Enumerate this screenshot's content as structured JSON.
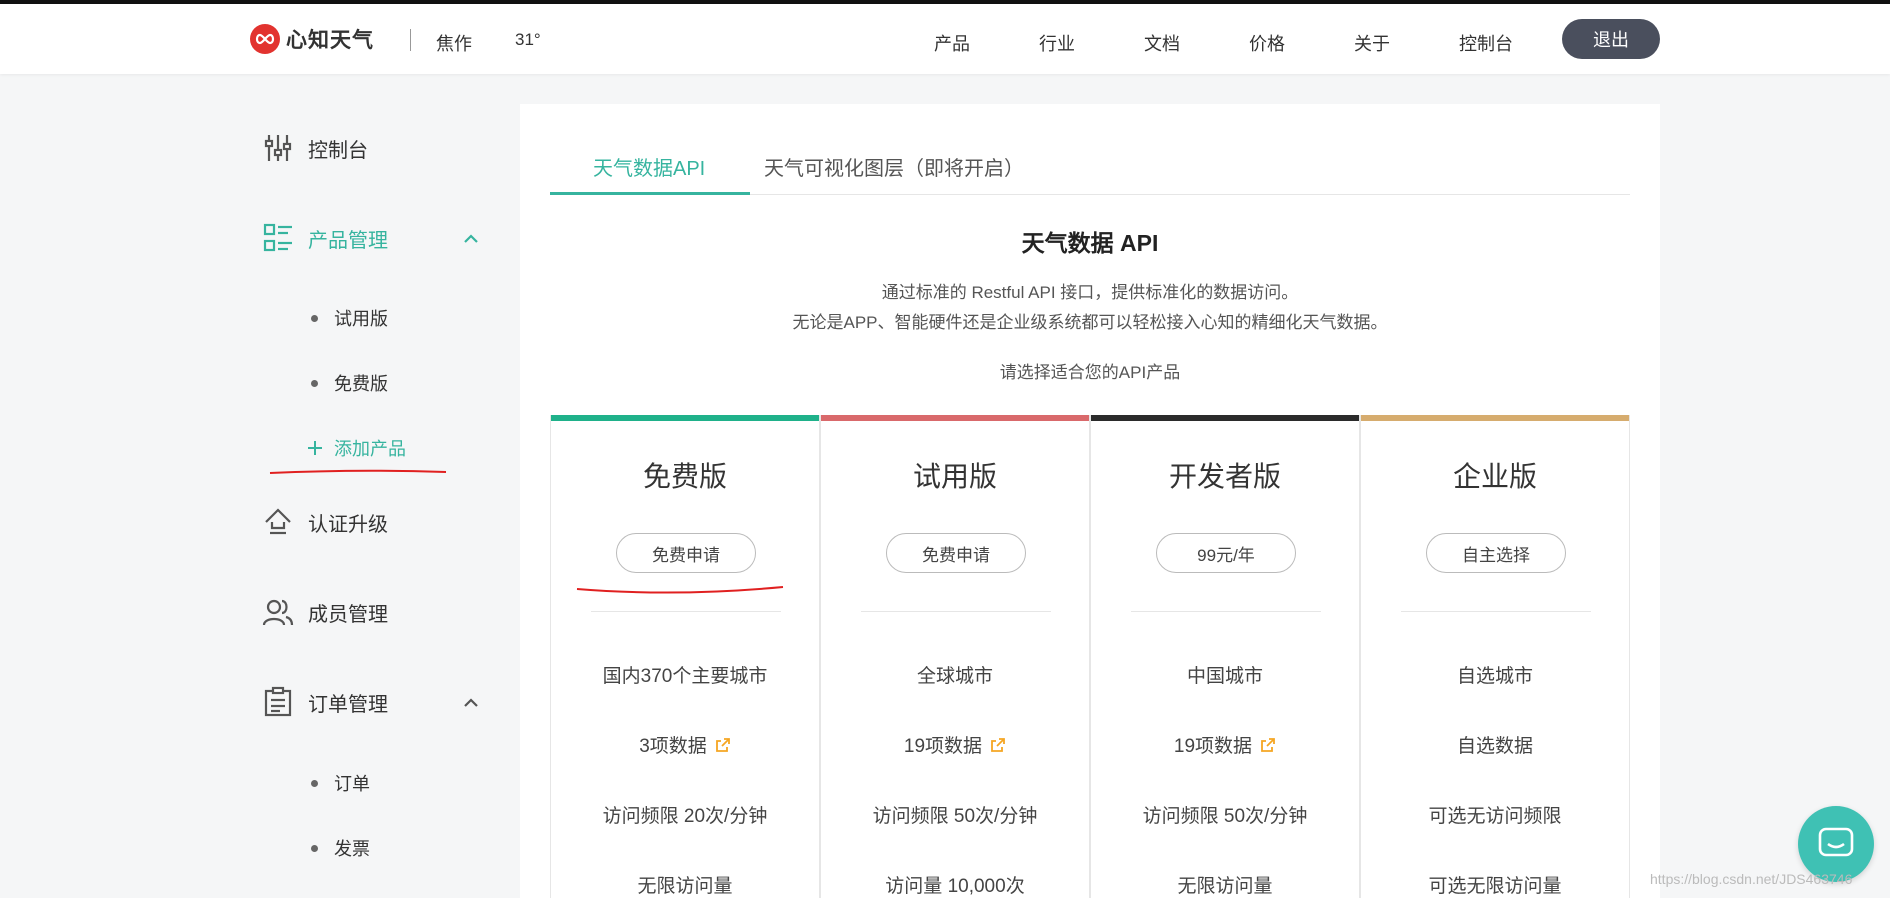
{
  "header": {
    "logo_text": "心知天气",
    "city": "焦作",
    "temperature": "31°",
    "nav": [
      "产品",
      "行业",
      "文档",
      "价格",
      "关于",
      "控制台"
    ],
    "logout_label": "退出"
  },
  "sidebar": {
    "items": [
      {
        "label": "控制台",
        "icon": "sliders-icon"
      },
      {
        "label": "产品管理",
        "icon": "list-icon",
        "active": true
      },
      {
        "label": "认证升级",
        "icon": "upload-icon"
      },
      {
        "label": "成员管理",
        "icon": "users-icon"
      },
      {
        "label": "订单管理",
        "icon": "clipboard-icon"
      }
    ],
    "product_sub": [
      "试用版",
      "免费版"
    ],
    "add_product": "添加产品",
    "order_sub": [
      "订单",
      "发票"
    ]
  },
  "main": {
    "tabs": [
      "天气数据API",
      "天气可视化图层（即将开启）"
    ],
    "title": "天气数据 API",
    "desc_line1": "通过标准的 Restful API 接口，提供标准化的数据访问。",
    "desc_line2": "无论是APP、智能硬件还是企业级系统都可以轻松接入心知的精细化天气数据。",
    "select_hint": "请选择适合您的API产品",
    "cards": [
      {
        "name": "免费版",
        "button": "免费申请",
        "color": "#1fb18a",
        "features": [
          "国内370个主要城市",
          "3项数据",
          "访问频限 20次/分钟",
          "无限访问量"
        ]
      },
      {
        "name": "试用版",
        "button": "免费申请",
        "color": "#d9696b",
        "features": [
          "全球城市",
          "19项数据",
          "访问频限 50次/分钟",
          "访问量 10,000次"
        ]
      },
      {
        "name": "开发者版",
        "button": "99元/年",
        "color": "#2b2b2b",
        "features": [
          "中国城市",
          "19项数据",
          "访问频限 50次/分钟",
          "无限访问量"
        ]
      },
      {
        "name": "企业版",
        "button": "自主选择",
        "color": "#d6ac6e",
        "features": [
          "自选城市",
          "自选数据",
          "可选无访问频限",
          "可选无限访问量"
        ]
      }
    ]
  },
  "watermark": "https://blog.csdn.net/JDS463746",
  "colors": {
    "accent": "#36b49f",
    "logout_bg": "#4a4f5d"
  }
}
